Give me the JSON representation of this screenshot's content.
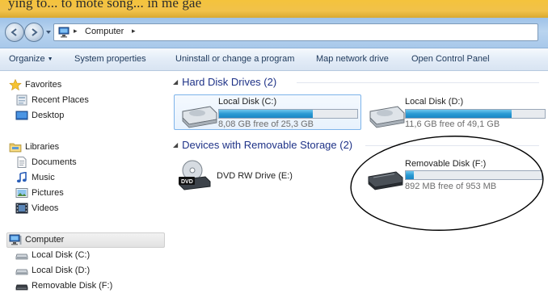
{
  "banner": {
    "text": "ying to... to mote song... in me gae"
  },
  "address": {
    "icon": "computer-icon",
    "crumb": "Computer",
    "arrow": "▸"
  },
  "commands": [
    {
      "label": "Organize",
      "has_caret": true
    },
    {
      "label": "System properties"
    },
    {
      "label": "Uninstall or change a program"
    },
    {
      "label": "Map network drive"
    },
    {
      "label": "Open Control Panel"
    }
  ],
  "nav": {
    "favorites": {
      "label": "Favorites",
      "icon": "star-icon"
    },
    "favorites_items": [
      {
        "label": "Recent Places",
        "icon": "recent-places-icon"
      },
      {
        "label": "Desktop",
        "icon": "desktop-icon"
      }
    ],
    "libraries": {
      "label": "Libraries",
      "icon": "libraries-icon"
    },
    "library_items": [
      {
        "label": "Documents",
        "icon": "documents-icon"
      },
      {
        "label": "Music",
        "icon": "music-icon"
      },
      {
        "label": "Pictures",
        "icon": "pictures-icon"
      },
      {
        "label": "Videos",
        "icon": "videos-icon"
      }
    ],
    "computer": {
      "label": "Computer",
      "icon": "computer-icon",
      "selected": true
    },
    "computer_items": [
      {
        "label": "Local Disk (C:)",
        "icon": "hard-drive-icon"
      },
      {
        "label": "Local Disk (D:)",
        "icon": "hard-drive-icon"
      },
      {
        "label": "Removable Disk (F:)",
        "icon": "removable-drive-icon"
      }
    ]
  },
  "groups": {
    "hdd": {
      "title": "Hard Disk Drives (2)"
    },
    "removable": {
      "title": "Devices with Removable Storage (2)"
    }
  },
  "drives": {
    "c": {
      "name": "Local Disk (C:)",
      "free": "8,08 GB free of 25,3 GB",
      "used_fraction": 0.68,
      "selected": true
    },
    "d": {
      "name": "Local Disk (D:)",
      "free": "11,6 GB free of 49,1 GB",
      "used_fraction": 0.76
    },
    "e": {
      "name": "DVD RW Drive (E:)",
      "icon_text": "DVD"
    },
    "f": {
      "name": "Removable Disk (F:)",
      "free": "892 MB free of 953 MB",
      "used_fraction": 0.06
    }
  },
  "colors": {
    "bar_fill": "#1a86c4",
    "group_header": "#1e3287",
    "annotation": "#000000"
  }
}
